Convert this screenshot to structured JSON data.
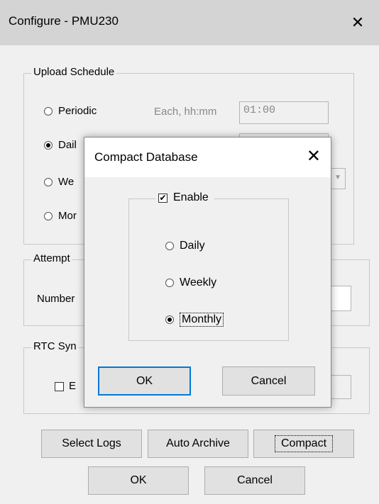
{
  "window": {
    "title": "Configure - PMU230",
    "close_glyph": "✕"
  },
  "upload_schedule": {
    "legend": "Upload Schedule",
    "options": [
      {
        "label": "Periodic",
        "selected": false
      },
      {
        "label": "Dail",
        "selected": true
      },
      {
        "label": "We",
        "selected": false
      },
      {
        "label": "Mor",
        "selected": false
      }
    ],
    "each_label": "Each, hh:mm",
    "each_value": "01:00",
    "dropdown_arrow": "▾"
  },
  "attempts": {
    "legend": "Attempt",
    "number_label": "Number"
  },
  "rtc": {
    "legend": "RTC Syn",
    "enable_label": "E",
    "checked": false
  },
  "bottom_buttons": {
    "select_logs": "Select Logs",
    "auto_archive": "Auto Archive",
    "compact": "Compact",
    "ok": "OK",
    "cancel": "Cancel"
  },
  "compact_dialog": {
    "title": "Compact Database",
    "close_glyph": "✕",
    "enable_label": "Enable",
    "enable_checked": true,
    "options": [
      {
        "label": "Daily",
        "selected": false
      },
      {
        "label": "Weekly",
        "selected": false
      },
      {
        "label": "Monthly",
        "selected": true
      }
    ],
    "ok": "OK",
    "cancel": "Cancel"
  }
}
